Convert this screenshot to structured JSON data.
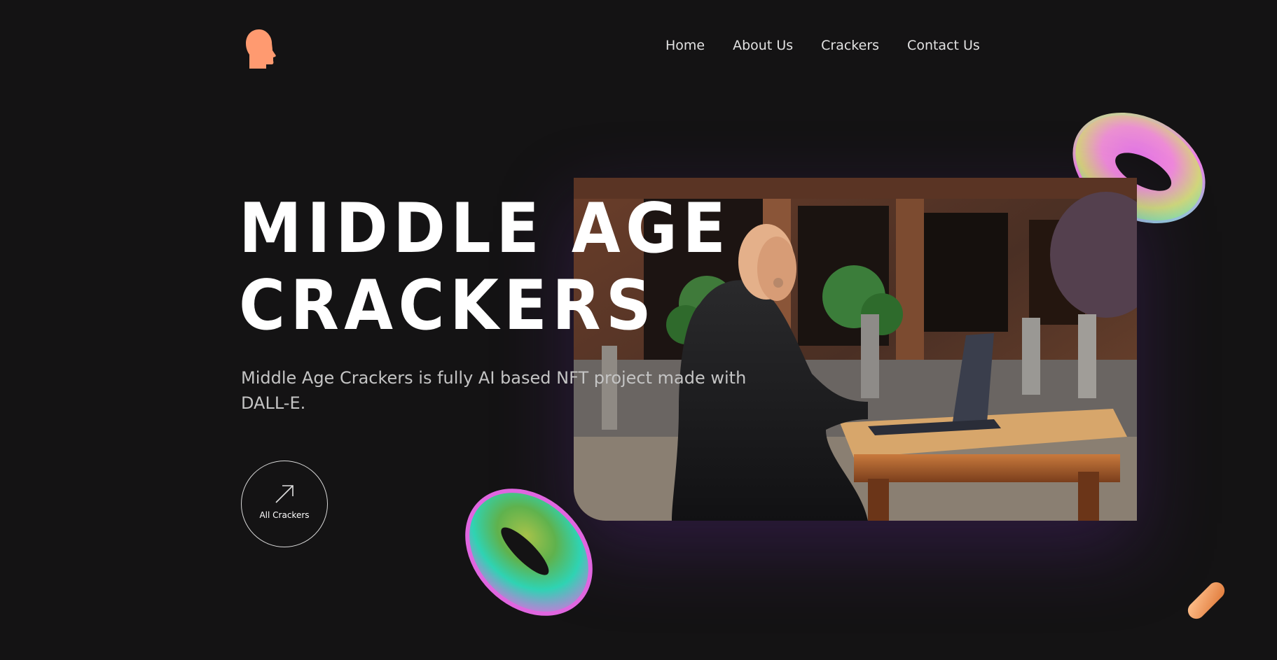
{
  "header": {
    "logo_icon": "head-profile-icon",
    "nav": [
      {
        "label": "Home"
      },
      {
        "label": "About Us"
      },
      {
        "label": "Crackers"
      },
      {
        "label": "Contact Us"
      }
    ]
  },
  "hero": {
    "title_line1": "MIDDLE AGE",
    "title_line2": "CRACKERS",
    "description": "Middle Age Crackers is fully AI based NFT project made with DALL-E.",
    "cta_label": "All Crackers",
    "cta_icon": "arrow-up-right-icon"
  },
  "colors": {
    "background": "#141314",
    "accent": "#ff9a70",
    "text": "#ffffff",
    "muted_text": "#c4c4c4"
  }
}
